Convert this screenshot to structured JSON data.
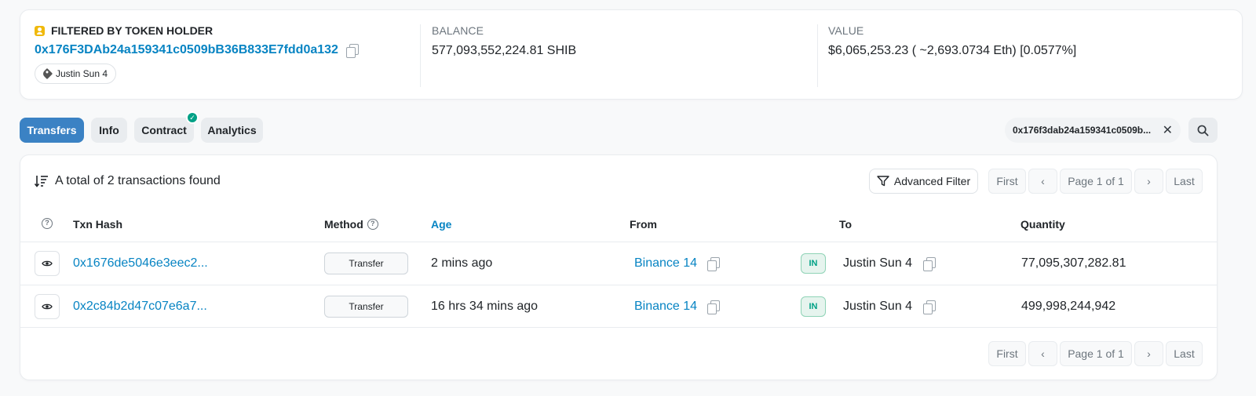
{
  "holder": {
    "label": "FILTERED BY TOKEN HOLDER",
    "address": "0x176F3DAb24a159341c0509bB36B833E7fdd0a132",
    "tag": "Justin Sun 4"
  },
  "balance": {
    "label": "BALANCE",
    "value": "577,093,552,224.81 SHIB"
  },
  "value": {
    "label": "VALUE",
    "value": "$6,065,253.23 ( ~2,693.0734 Eth) [0.0577%]"
  },
  "tabs": [
    {
      "label": "Transfers"
    },
    {
      "label": "Info"
    },
    {
      "label": "Contract"
    },
    {
      "label": "Analytics"
    }
  ],
  "filter_chip": {
    "text": "0x176f3dab24a159341c0509b..."
  },
  "summary": "A total of 2 transactions found",
  "advanced_filter": "Advanced Filter",
  "pagination": {
    "first": "First",
    "page": "Page 1 of 1",
    "last": "Last"
  },
  "columns": {
    "txn_hash": "Txn Hash",
    "method": "Method",
    "age": "Age",
    "from": "From",
    "to": "To",
    "quantity": "Quantity"
  },
  "rows": [
    {
      "hash": "0x1676de5046e3eec2...",
      "method": "Transfer",
      "age": "2 mins ago",
      "from": "Binance 14",
      "direction": "IN",
      "to": "Justin Sun 4",
      "quantity": "77,095,307,282.81"
    },
    {
      "hash": "0x2c84b2d47c07e6a7...",
      "method": "Transfer",
      "age": "16 hrs 34 mins ago",
      "from": "Binance 14",
      "direction": "IN",
      "to": "Justin Sun 4",
      "quantity": "499,998,244,942"
    }
  ],
  "colors": {
    "accent": "#0784c3",
    "active_tab": "#3b82c4",
    "success": "#00a186",
    "holder_icon": "#f0b90b"
  }
}
